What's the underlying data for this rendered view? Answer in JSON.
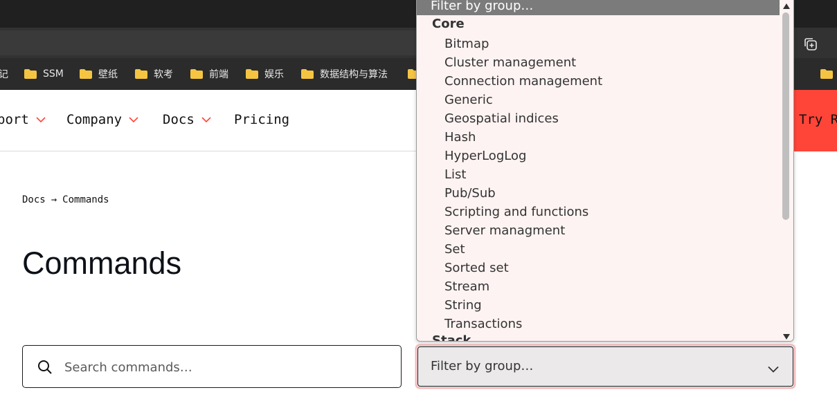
{
  "browser": {
    "bookmarks": [
      {
        "label": "记"
      },
      {
        "label": "SSM"
      },
      {
        "label": "壁纸"
      },
      {
        "label": "软考"
      },
      {
        "label": "前端"
      },
      {
        "label": "娱乐"
      },
      {
        "label": "数据结构与算法"
      }
    ]
  },
  "nav": {
    "items": [
      {
        "label": "port"
      },
      {
        "label": "Company"
      },
      {
        "label": "Docs"
      },
      {
        "label": "Pricing"
      }
    ],
    "cta_label": "Try R"
  },
  "breadcrumb": {
    "docs": "Docs",
    "separator": "→",
    "current": "Commands"
  },
  "page": {
    "title": "Commands"
  },
  "search": {
    "placeholder": "Search commands…",
    "value": ""
  },
  "filter": {
    "selected": "Filter by group…",
    "dropdown_header": "Filter by group…",
    "groups": [
      {
        "label": "Core",
        "options": [
          "Bitmap",
          "Cluster management",
          "Connection management",
          "Generic",
          "Geospatial indices",
          "Hash",
          "HyperLogLog",
          "List",
          "Pub/Sub",
          "Scripting and functions",
          "Server managment",
          "Set",
          "Sorted set",
          "Stream",
          "String",
          "Transactions"
        ]
      },
      {
        "label": "Stack",
        "options": []
      }
    ]
  },
  "colors": {
    "accent": "#ff4438",
    "dropdown_bg": "#fdf3f2",
    "focus_ring": "#f2b7b9"
  }
}
